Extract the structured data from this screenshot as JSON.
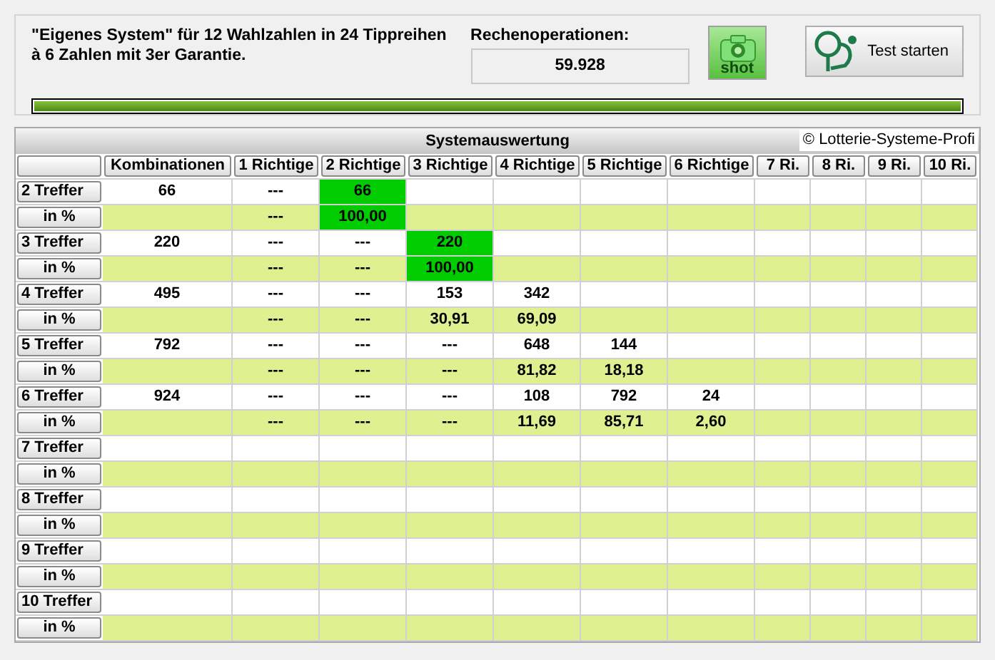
{
  "header": {
    "description": "\"Eigenes System\" für 12 Wahlzahlen in 24 Tippreihen à 6 Zahlen mit 3er Garantie.",
    "operations_label": "Rechenoperationen:",
    "operations_value": "59.928",
    "shot_button": "shot",
    "test_button": "Test starten",
    "progress": {
      "level": 1
    }
  },
  "table": {
    "title": "Systemauswertung",
    "copyright": "© Lotterie-Systeme-Profi",
    "columns": [
      "Kombinationen",
      "1 Richtige",
      "2 Richtige",
      "3 Richtige",
      "4 Richtige",
      "5 Richtige",
      "6 Richtige",
      "7 Ri.",
      "8 Ri.",
      "9 Ri.",
      "10 Ri."
    ],
    "rows": [
      {
        "label": "2 Treffer",
        "kind": "count",
        "cells": [
          {
            "text": "66",
            "highlighted": false
          },
          {
            "text": "---",
            "highlighted": false
          },
          {
            "text": "66",
            "highlighted": true
          },
          {
            "highlighted": false
          },
          {
            "highlighted": false
          },
          {
            "highlighted": false
          },
          {
            "highlighted": false
          },
          {
            "highlighted": false
          },
          {
            "highlighted": false
          },
          {
            "highlighted": false
          },
          {
            "highlighted": false
          }
        ]
      },
      {
        "label": "in %",
        "kind": "percent",
        "cells": [
          {
            "highlighted": false
          },
          {
            "text": "---",
            "highlighted": false
          },
          {
            "text": "100,00",
            "highlighted": true
          },
          {
            "highlighted": false
          },
          {
            "highlighted": false
          },
          {
            "highlighted": false
          },
          {
            "highlighted": false
          },
          {
            "highlighted": false
          },
          {
            "highlighted": false
          },
          {
            "highlighted": false
          },
          {
            "highlighted": false
          }
        ]
      },
      {
        "label": "3 Treffer",
        "kind": "count",
        "cells": [
          {
            "text": "220",
            "highlighted": false
          },
          {
            "text": "---",
            "highlighted": false
          },
          {
            "text": "---",
            "highlighted": false
          },
          {
            "text": "220",
            "highlighted": true
          },
          {
            "highlighted": false
          },
          {
            "highlighted": false
          },
          {
            "highlighted": false
          },
          {
            "highlighted": false
          },
          {
            "highlighted": false
          },
          {
            "highlighted": false
          },
          {
            "highlighted": false
          }
        ]
      },
      {
        "label": "in %",
        "kind": "percent",
        "cells": [
          {
            "highlighted": false
          },
          {
            "text": "---",
            "highlighted": false
          },
          {
            "text": "---",
            "highlighted": false
          },
          {
            "text": "100,00",
            "highlighted": true
          },
          {
            "highlighted": false
          },
          {
            "highlighted": false
          },
          {
            "highlighted": false
          },
          {
            "highlighted": false
          },
          {
            "highlighted": false
          },
          {
            "highlighted": false
          },
          {
            "highlighted": false
          }
        ]
      },
      {
        "label": "4 Treffer",
        "kind": "count",
        "cells": [
          {
            "text": "495",
            "highlighted": false
          },
          {
            "text": "---",
            "highlighted": false
          },
          {
            "text": "---",
            "highlighted": false
          },
          {
            "text": "153",
            "highlighted": false
          },
          {
            "text": "342",
            "highlighted": false
          },
          {
            "highlighted": false
          },
          {
            "highlighted": false
          },
          {
            "highlighted": false
          },
          {
            "highlighted": false
          },
          {
            "highlighted": false
          },
          {
            "highlighted": false
          }
        ]
      },
      {
        "label": "in %",
        "kind": "percent",
        "cells": [
          {
            "highlighted": false
          },
          {
            "text": "---",
            "highlighted": false
          },
          {
            "text": "---",
            "highlighted": false
          },
          {
            "text": "30,91",
            "highlighted": false
          },
          {
            "text": "69,09",
            "highlighted": false
          },
          {
            "highlighted": false
          },
          {
            "highlighted": false
          },
          {
            "highlighted": false
          },
          {
            "highlighted": false
          },
          {
            "highlighted": false
          },
          {
            "highlighted": false
          }
        ]
      },
      {
        "label": "5 Treffer",
        "kind": "count",
        "cells": [
          {
            "text": "792",
            "highlighted": false
          },
          {
            "text": "---",
            "highlighted": false
          },
          {
            "text": "---",
            "highlighted": false
          },
          {
            "text": "---",
            "highlighted": false
          },
          {
            "text": "648",
            "highlighted": false
          },
          {
            "text": "144",
            "highlighted": false
          },
          {
            "highlighted": false
          },
          {
            "highlighted": false
          },
          {
            "highlighted": false
          },
          {
            "highlighted": false
          },
          {
            "highlighted": false
          }
        ]
      },
      {
        "label": "in %",
        "kind": "percent",
        "cells": [
          {
            "highlighted": false
          },
          {
            "text": "---",
            "highlighted": false
          },
          {
            "text": "---",
            "highlighted": false
          },
          {
            "text": "---",
            "highlighted": false
          },
          {
            "text": "81,82",
            "highlighted": false
          },
          {
            "text": "18,18",
            "highlighted": false
          },
          {
            "highlighted": false
          },
          {
            "highlighted": false
          },
          {
            "highlighted": false
          },
          {
            "highlighted": false
          },
          {
            "highlighted": false
          }
        ]
      },
      {
        "label": "6 Treffer",
        "kind": "count",
        "cells": [
          {
            "text": "924",
            "highlighted": false
          },
          {
            "text": "---",
            "highlighted": false
          },
          {
            "text": "---",
            "highlighted": false
          },
          {
            "text": "---",
            "highlighted": false
          },
          {
            "text": "108",
            "highlighted": false
          },
          {
            "text": "792",
            "highlighted": false
          },
          {
            "text": "24",
            "highlighted": false
          },
          {
            "highlighted": false
          },
          {
            "highlighted": false
          },
          {
            "highlighted": false
          },
          {
            "highlighted": false
          }
        ]
      },
      {
        "label": "in %",
        "kind": "percent",
        "cells": [
          {
            "highlighted": false
          },
          {
            "text": "---",
            "highlighted": false
          },
          {
            "text": "---",
            "highlighted": false
          },
          {
            "text": "---",
            "highlighted": false
          },
          {
            "text": "11,69",
            "highlighted": false
          },
          {
            "text": "85,71",
            "highlighted": false
          },
          {
            "text": "2,60",
            "highlighted": false
          },
          {
            "highlighted": false
          },
          {
            "highlighted": false
          },
          {
            "highlighted": false
          },
          {
            "highlighted": false
          }
        ]
      },
      {
        "label": "7 Treffer",
        "kind": "count",
        "cells": [
          {
            "highlighted": false
          },
          {
            "highlighted": false
          },
          {
            "highlighted": false
          },
          {
            "highlighted": false
          },
          {
            "highlighted": false
          },
          {
            "highlighted": false
          },
          {
            "highlighted": false
          },
          {
            "highlighted": false
          },
          {
            "highlighted": false
          },
          {
            "highlighted": false
          },
          {
            "highlighted": false
          }
        ]
      },
      {
        "label": "in %",
        "kind": "percent",
        "cells": [
          {
            "highlighted": false
          },
          {
            "highlighted": false
          },
          {
            "highlighted": false
          },
          {
            "highlighted": false
          },
          {
            "highlighted": false
          },
          {
            "highlighted": false
          },
          {
            "highlighted": false
          },
          {
            "highlighted": false
          },
          {
            "highlighted": false
          },
          {
            "highlighted": false
          },
          {
            "highlighted": false
          }
        ]
      },
      {
        "label": "8 Treffer",
        "kind": "count",
        "cells": [
          {
            "highlighted": false
          },
          {
            "highlighted": false
          },
          {
            "highlighted": false
          },
          {
            "highlighted": false
          },
          {
            "highlighted": false
          },
          {
            "highlighted": false
          },
          {
            "highlighted": false
          },
          {
            "highlighted": false
          },
          {
            "highlighted": false
          },
          {
            "highlighted": false
          },
          {
            "highlighted": false
          }
        ]
      },
      {
        "label": "in %",
        "kind": "percent",
        "cells": [
          {
            "highlighted": false
          },
          {
            "highlighted": false
          },
          {
            "highlighted": false
          },
          {
            "highlighted": false
          },
          {
            "highlighted": false
          },
          {
            "highlighted": false
          },
          {
            "highlighted": false
          },
          {
            "highlighted": false
          },
          {
            "highlighted": false
          },
          {
            "highlighted": false
          },
          {
            "highlighted": false
          }
        ]
      },
      {
        "label": "9 Treffer",
        "kind": "count",
        "cells": [
          {
            "highlighted": false
          },
          {
            "highlighted": false
          },
          {
            "highlighted": false
          },
          {
            "highlighted": false
          },
          {
            "highlighted": false
          },
          {
            "highlighted": false
          },
          {
            "highlighted": false
          },
          {
            "highlighted": false
          },
          {
            "highlighted": false
          },
          {
            "highlighted": false
          },
          {
            "highlighted": false
          }
        ]
      },
      {
        "label": "in %",
        "kind": "percent",
        "cells": [
          {
            "highlighted": false
          },
          {
            "highlighted": false
          },
          {
            "highlighted": false
          },
          {
            "highlighted": false
          },
          {
            "highlighted": false
          },
          {
            "highlighted": false
          },
          {
            "highlighted": false
          },
          {
            "highlighted": false
          },
          {
            "highlighted": false
          },
          {
            "highlighted": false
          },
          {
            "highlighted": false
          }
        ]
      },
      {
        "label": "10 Treffer",
        "kind": "count",
        "cells": [
          {
            "highlighted": false
          },
          {
            "highlighted": false
          },
          {
            "highlighted": false
          },
          {
            "highlighted": false
          },
          {
            "highlighted": false
          },
          {
            "highlighted": false
          },
          {
            "highlighted": false
          },
          {
            "highlighted": false
          },
          {
            "highlighted": false
          },
          {
            "highlighted": false
          },
          {
            "highlighted": false
          }
        ]
      },
      {
        "label": "in %",
        "kind": "percent",
        "cells": [
          {
            "highlighted": false
          },
          {
            "highlighted": false
          },
          {
            "highlighted": false
          },
          {
            "highlighted": false
          },
          {
            "highlighted": false
          },
          {
            "highlighted": false
          },
          {
            "highlighted": false
          },
          {
            "highlighted": false
          },
          {
            "highlighted": false
          },
          {
            "highlighted": false
          },
          {
            "highlighted": false
          }
        ]
      }
    ]
  }
}
